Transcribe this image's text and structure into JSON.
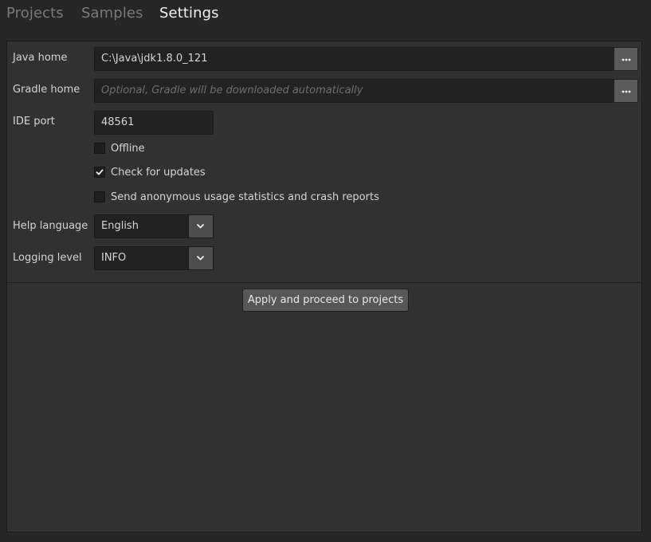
{
  "tabs": {
    "projects": "Projects",
    "samples": "Samples",
    "settings": "Settings"
  },
  "active_tab": "Settings",
  "settings": {
    "java_home": {
      "label": "Java home",
      "value": "C:\\Java\\jdk1.8.0_121",
      "browse_label": "..."
    },
    "gradle_home": {
      "label": "Gradle home",
      "value": "",
      "placeholder": "Optional, Gradle will be downloaded automatically",
      "browse_label": "..."
    },
    "ide_port": {
      "label": "IDE port",
      "value": "48561"
    },
    "offline": {
      "label": "Offline",
      "checked": false
    },
    "check_updates": {
      "label": "Check for updates",
      "checked": true
    },
    "send_stats": {
      "label": "Send anonymous usage statistics and crash reports",
      "checked": false
    },
    "help_language": {
      "label": "Help language",
      "value": "English"
    },
    "logging_level": {
      "label": "Logging level",
      "value": "INFO"
    },
    "apply_button": "Apply and proceed to projects"
  },
  "icons": {
    "browse": "ellipsis-icon",
    "dropdown": "chevron-down-icon",
    "check": "checkmark-icon"
  },
  "colors": {
    "background": "#262626",
    "panel": "#313131",
    "field": "#222222",
    "button": "#575757",
    "text": "#d6d6d6",
    "active_tab": "#f2f2f2",
    "inactive_tab": "#7a7a7a"
  }
}
